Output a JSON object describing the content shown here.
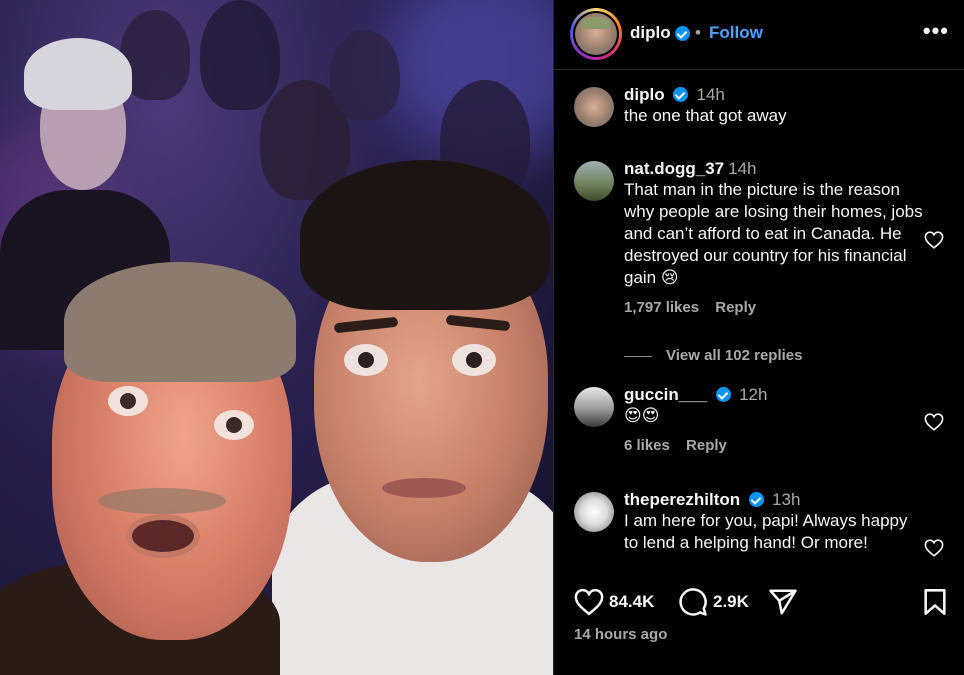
{
  "post": {
    "author": "diplo",
    "follow_label": "Follow",
    "separator": "•",
    "more_label": "•••"
  },
  "comments": [
    {
      "user": "diplo",
      "verified": true,
      "time": "14h",
      "text": "the one that got away",
      "likes": "",
      "reply_label": ""
    },
    {
      "user": "nat.dogg_37",
      "verified": false,
      "time": "14h",
      "text": "That man in the picture is the reason why people are losing their homes, jobs and can’t afford to eat in Canada. He destroyed our country for his financial gain 😢",
      "likes": "1,797 likes",
      "reply_label": "Reply",
      "view_replies": "View all 102 replies"
    },
    {
      "user": "guccin___",
      "verified": true,
      "time": "12h",
      "text": "😍😍",
      "likes": "6 likes",
      "reply_label": "Reply"
    },
    {
      "user": "theperezhilton",
      "verified": true,
      "time": "13h",
      "text": "I am here for you, papi! Always happy to lend a helping hand! Or more!",
      "likes": "",
      "reply_label": ""
    }
  ],
  "actions": {
    "likes_count": "84.4K",
    "comments_count": "2.9K",
    "posted_ago": "14 hours ago"
  },
  "icons": [
    "verified-icon",
    "more-icon",
    "heart-icon",
    "comment-icon",
    "share-icon",
    "save-icon"
  ],
  "colors": {
    "background": "#000000",
    "link": "#4aa3ff",
    "verified": "#0095f6",
    "muted": "#a8a8a8"
  }
}
